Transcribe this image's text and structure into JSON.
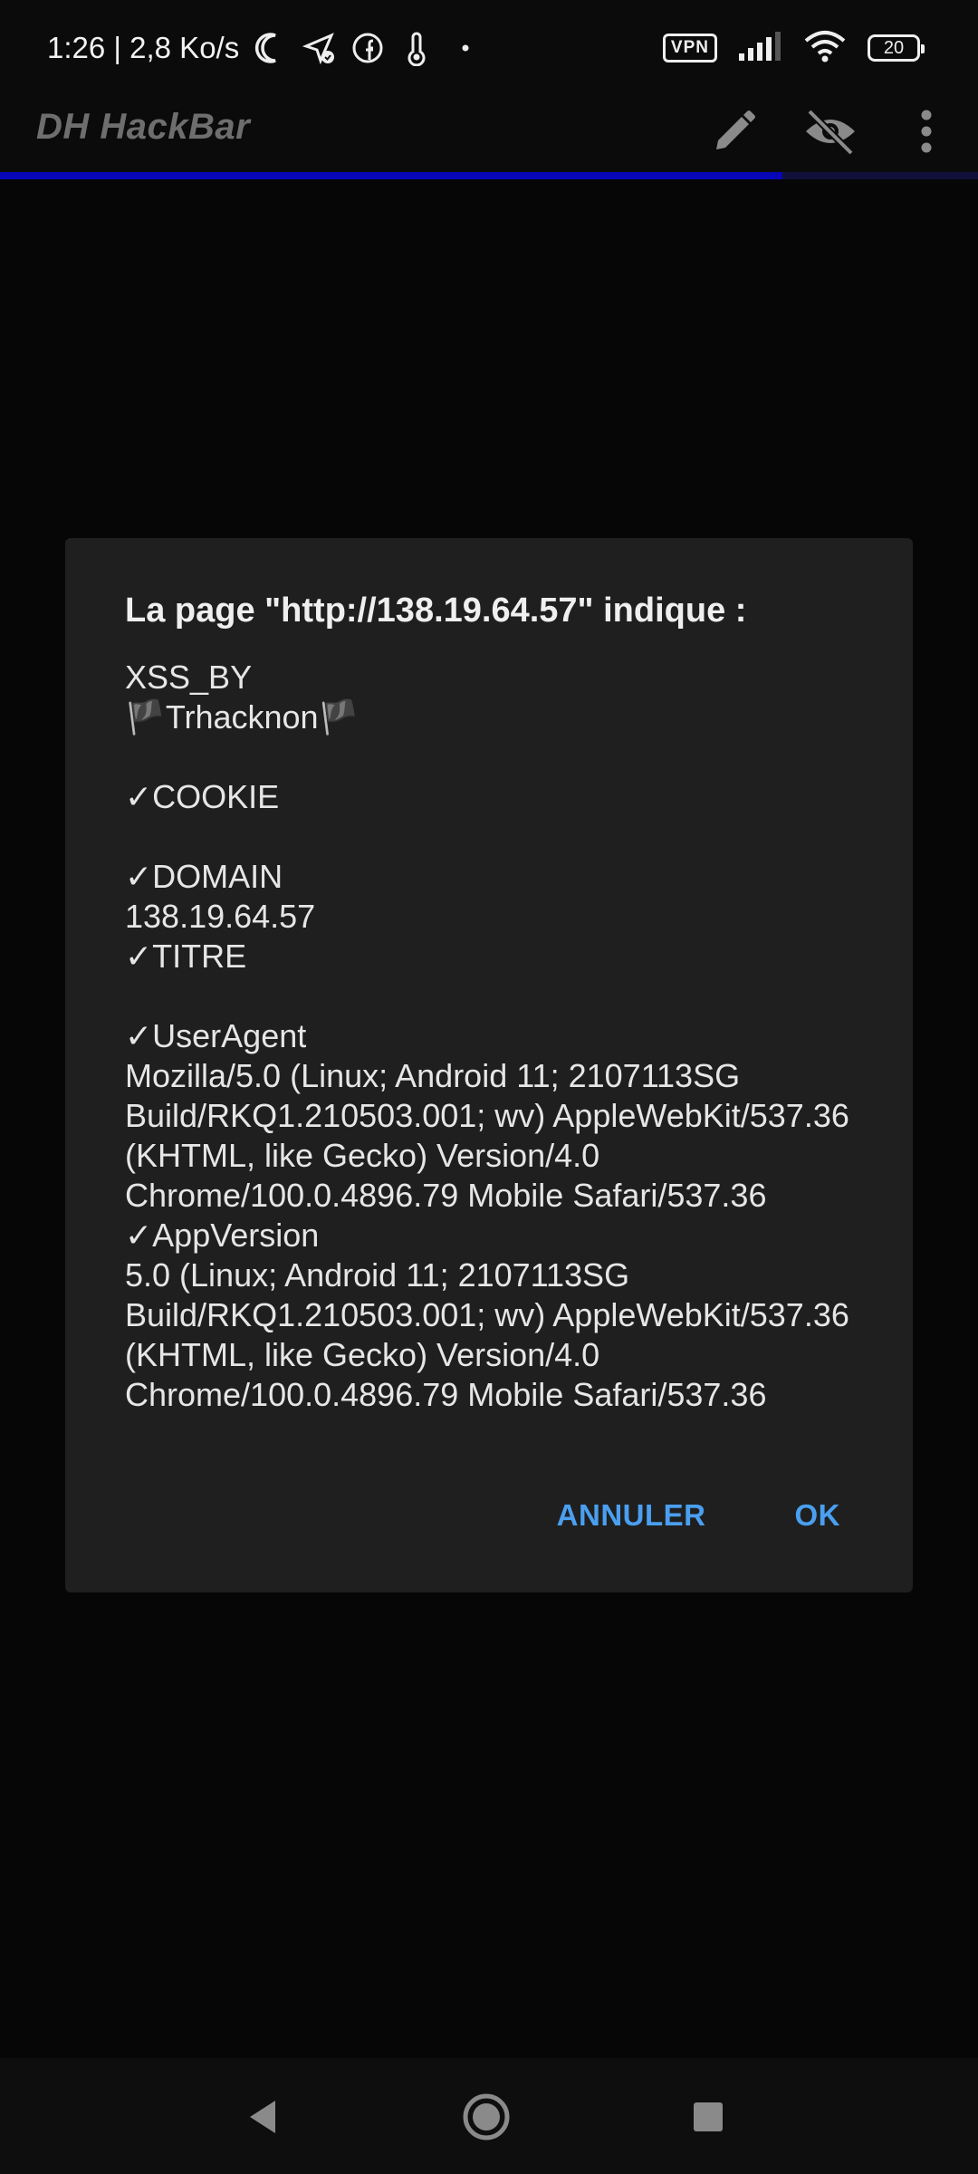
{
  "status_bar": {
    "time_speed": "1:26 | 2,8 Ko/s",
    "vpn": "VPN",
    "battery": "20",
    "icons": [
      "moon-icon",
      "location-check-icon",
      "facebook-icon",
      "thermometer-icon",
      "dot-icon",
      "vpn-icon",
      "signal-icon",
      "wifi-icon",
      "battery-icon"
    ]
  },
  "app_bar": {
    "title": "DH HackBar",
    "actions": [
      "edit-icon",
      "visibility-off-icon",
      "more-vert-icon"
    ],
    "progress_fraction": 0.8
  },
  "dialog": {
    "title": "La page \"http://138.19.64.57\" indique :",
    "message": "XSS_BY\n🏴Trhacknon🏴\n\n✓COOKIE\n\n✓DOMAIN\n138.19.64.57\n✓TITRE\n\n✓UserAgent\nMozilla/5.0 (Linux; Android 11; 2107113SG Build/RKQ1.210503.001; wv) AppleWebKit/537.36 (KHTML, like Gecko) Version/4.0 Chrome/100.0.4896.79 Mobile Safari/537.36\n✓AppVersion\n5.0 (Linux; Android 11; 2107113SG Build/RKQ1.210503.001; wv) AppleWebKit/537.36 (KHTML, like Gecko) Version/4.0 Chrome/100.0.4896.79 Mobile Safari/537.36",
    "cancel_label": "ANNULER",
    "ok_label": "OK"
  },
  "nav_bar": {
    "icons": [
      "back-icon",
      "home-icon",
      "recents-icon"
    ]
  },
  "colors": {
    "accent": "#4a9ff0",
    "progress": "#0707b8",
    "dialog_bg": "#1f1f1f"
  }
}
